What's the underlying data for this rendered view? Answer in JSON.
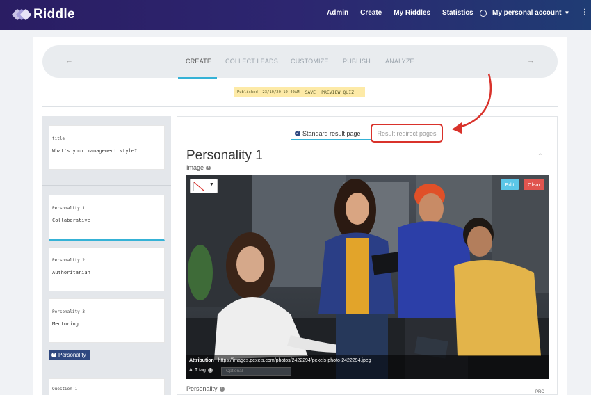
{
  "header": {
    "brand": "Riddle",
    "nav": [
      "Admin",
      "Create",
      "My Riddles",
      "Statistics"
    ],
    "account": "My personal account"
  },
  "steps": {
    "items": [
      "CREATE",
      "COLLECT LEADS",
      "CUSTOMIZE",
      "PUBLISH",
      "ANALYZE"
    ],
    "active": "CREATE"
  },
  "publish_bar": {
    "status": "Published: 23/10/20 10:40AM",
    "save": "SAVE",
    "preview": "PREVIEW QUIZ"
  },
  "sidebar": {
    "title_card": {
      "label": "title",
      "value": "What's your management style?"
    },
    "personalities": [
      {
        "label": "Personality 1",
        "value": "Collaborative"
      },
      {
        "label": "Personality 2",
        "value": "Authoritarian"
      },
      {
        "label": "Personality 3",
        "value": "Mentoring"
      }
    ],
    "add_button": "Personality",
    "question_card": {
      "label": "Question 1"
    }
  },
  "result_tabs": {
    "standard": "Standard result page",
    "redirect": "Result redirect pages"
  },
  "editor": {
    "heading": "Personality 1",
    "image_label": "Image",
    "edit": "Edit",
    "clear": "Clear",
    "attribution_label": "Attribution",
    "attribution_url": "https://images.pexels.com/photos/2422294/pexels-photo-2422294.jpeg",
    "alt_label": "ALT tag",
    "alt_placeholder": "Optional",
    "personality_label": "Personality",
    "pro_badge": "PRO"
  },
  "colors": {
    "accent": "#35b2d6",
    "highlight": "#d9322b",
    "nav_bg": "#2a1d63"
  }
}
